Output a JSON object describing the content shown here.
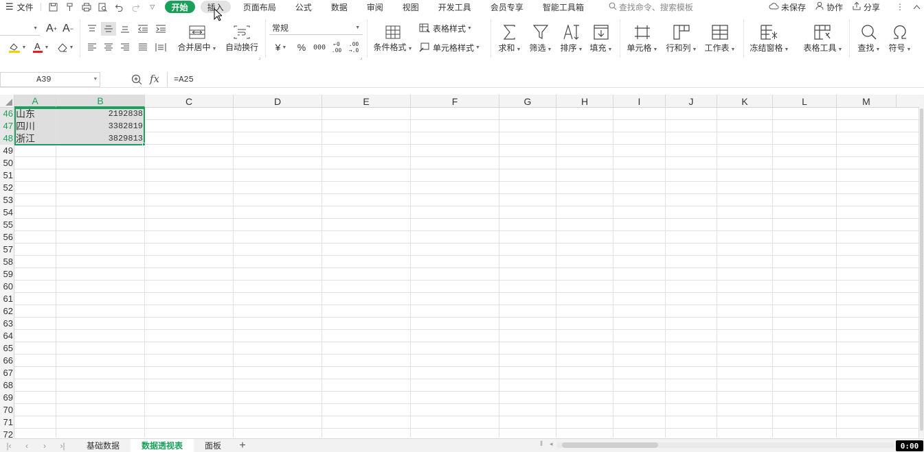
{
  "menubar": {
    "file_label": "文件",
    "tabs": [
      {
        "label": "开始",
        "state": "active"
      },
      {
        "label": "插入",
        "state": "hover"
      },
      {
        "label": "页面布局",
        "state": ""
      },
      {
        "label": "公式",
        "state": ""
      },
      {
        "label": "数据",
        "state": ""
      },
      {
        "label": "审阅",
        "state": ""
      },
      {
        "label": "视图",
        "state": ""
      },
      {
        "label": "开发工具",
        "state": ""
      },
      {
        "label": "会员专享",
        "state": ""
      },
      {
        "label": "智能工具箱",
        "state": ""
      }
    ],
    "search_placeholder": "查找命令、搜索模板",
    "unsaved_label": "未保存",
    "collab_label": "协作",
    "share_label": "分享"
  },
  "ribbon": {
    "merge_center": "合并居中",
    "wrap_text": "自动换行",
    "number_format": "常规",
    "conditional_format": "条件格式",
    "table_style": "表格样式",
    "cell_style": "单元格样式",
    "sum": "求和",
    "filter": "筛选",
    "sort": "排序",
    "fill": "填充",
    "cell": "单元格",
    "row_col": "行和列",
    "worksheet": "工作表",
    "freeze": "冻结窗格",
    "table_tools": "表格工具",
    "find": "查找",
    "symbol": "符号",
    "currency_symbol": "¥",
    "percent_symbol": "%",
    "thousands_symbol": "000",
    "inc_decimal": "←0\n.00",
    "dec_decimal": ".00\n→.0"
  },
  "formula_bar": {
    "name_box": "A39",
    "fx_label": "fx",
    "formula": "=A25"
  },
  "grid": {
    "columns": [
      "A",
      "B",
      "C",
      "D",
      "E",
      "F",
      "G",
      "H",
      "I",
      "J",
      "K",
      "L",
      "M"
    ],
    "selected_columns": [
      "A",
      "B"
    ],
    "rows": [
      {
        "num": "46",
        "a": "山东",
        "b": "2192838",
        "sel": true
      },
      {
        "num": "47",
        "a": "四川",
        "b": "3382819",
        "sel": true
      },
      {
        "num": "48",
        "a": "浙江",
        "b": "3829813",
        "sel": true
      },
      {
        "num": "49",
        "a": "",
        "b": ""
      },
      {
        "num": "50",
        "a": "",
        "b": ""
      },
      {
        "num": "51",
        "a": "",
        "b": ""
      },
      {
        "num": "52",
        "a": "",
        "b": ""
      },
      {
        "num": "53",
        "a": "",
        "b": ""
      },
      {
        "num": "54",
        "a": "",
        "b": ""
      },
      {
        "num": "55",
        "a": "",
        "b": ""
      },
      {
        "num": "56",
        "a": "",
        "b": ""
      },
      {
        "num": "57",
        "a": "",
        "b": ""
      },
      {
        "num": "58",
        "a": "",
        "b": ""
      },
      {
        "num": "59",
        "a": "",
        "b": ""
      },
      {
        "num": "60",
        "a": "",
        "b": ""
      },
      {
        "num": "61",
        "a": "",
        "b": ""
      },
      {
        "num": "62",
        "a": "",
        "b": ""
      },
      {
        "num": "63",
        "a": "",
        "b": ""
      },
      {
        "num": "64",
        "a": "",
        "b": ""
      },
      {
        "num": "65",
        "a": "",
        "b": ""
      },
      {
        "num": "66",
        "a": "",
        "b": ""
      },
      {
        "num": "67",
        "a": "",
        "b": ""
      },
      {
        "num": "68",
        "a": "",
        "b": ""
      },
      {
        "num": "69",
        "a": "",
        "b": ""
      },
      {
        "num": "70",
        "a": "",
        "b": ""
      },
      {
        "num": "71",
        "a": "",
        "b": ""
      },
      {
        "num": "72",
        "a": "",
        "b": ""
      }
    ]
  },
  "sheets": {
    "tabs": [
      {
        "label": "基础数据",
        "active": false
      },
      {
        "label": "数据透视表",
        "active": true
      },
      {
        "label": "面板",
        "active": false
      }
    ],
    "add_label": "+"
  },
  "status": {
    "timer": "0:00"
  },
  "colors": {
    "accent": "#1aa05a",
    "selection_fill": "#dedede",
    "header_bg": "#f4f4f4"
  }
}
